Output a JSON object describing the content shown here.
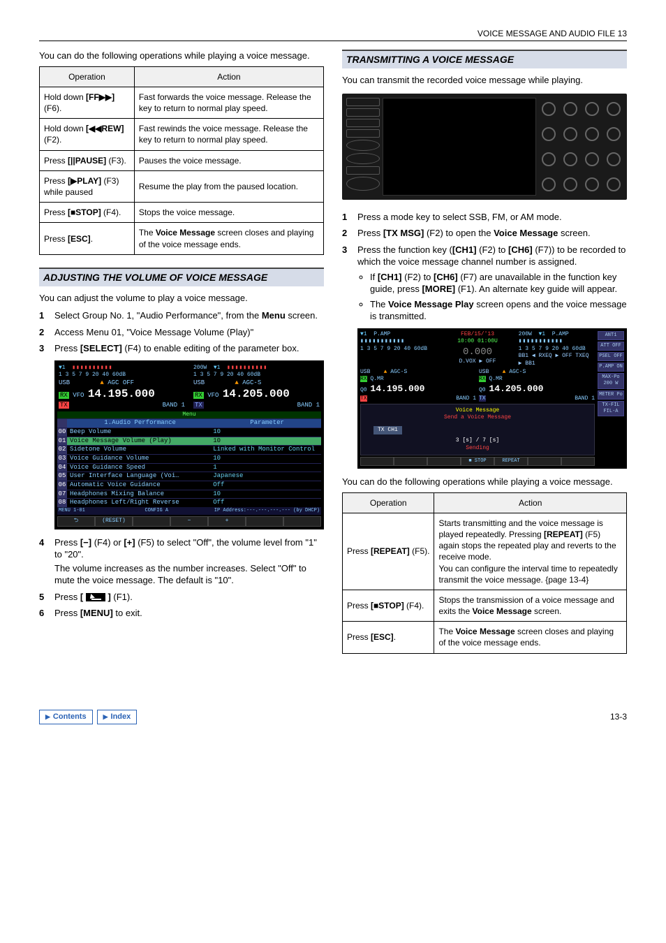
{
  "header": "VOICE MESSAGE AND AUDIO FILE 13",
  "left": {
    "intro": "You can do the following operations while playing a voice message.",
    "table": {
      "headers": [
        "Operation",
        "Action"
      ],
      "rows": [
        {
          "op_pre": "Hold down ",
          "op_b": "[FF▶▶]",
          "op_post": " (F6).",
          "act": "Fast forwards the voice message. Release the key to return to normal play speed."
        },
        {
          "op_pre": "Hold down ",
          "op_b": "[◀◀REW]",
          "op_post": " (F2).",
          "act": "Fast rewinds the voice message. Release the key to return to normal play speed."
        },
        {
          "op_pre": "Press ",
          "op_b": "[||PAUSE]",
          "op_post": " (F3).",
          "act": "Pauses the voice message."
        },
        {
          "op_pre": "Press ",
          "op_b": "[▶PLAY]",
          "op_post": " (F3) while paused",
          "act": "Resume the play from the paused location."
        },
        {
          "op_pre": "Press ",
          "op_b": "[■STOP]",
          "op_post": " (F4).",
          "act": "Stops the voice message."
        },
        {
          "op_pre": "Press ",
          "op_b": "[ESC]",
          "op_post": ".",
          "act_pre": "The ",
          "act_b": "Voice Message",
          "act_post": " screen closes and playing of the voice message ends."
        }
      ]
    },
    "sec2_title": "ADJUSTING THE VOLUME OF VOICE MESSAGE",
    "sec2_intro": "You can adjust the volume to play a voice message.",
    "steps1": {
      "s1_a": "Select Group No. 1, \"Audio Performance\", from the ",
      "s1_b": "Menu",
      "s1_c": " screen.",
      "s2": "Access Menu 01, \"Voice Message Volume (Play)\"",
      "s3_a": "Press ",
      "s3_b": "[SELECT]",
      "s3_c": " (F4) to enable editing of the parameter box."
    },
    "menu_shot": {
      "left_mode": "USB",
      "left_rxtx": "RX\nTX",
      "left_vfo": "VFO",
      "left_freq": "14.195.000",
      "left_band": "BAND 1",
      "agc_left": "AGC OFF",
      "right_mode": "USB",
      "right_vfo": "VFO",
      "right_freq": "14.205.000",
      "right_band": "BAND 1",
      "agc_right": "AGC-S",
      "scale": "1  3  5  7  9   20  40 60dB",
      "power": "200W",
      "menu_header_left": "1.Audio Performance",
      "menu_header_right": "Parameter",
      "rows": [
        [
          "00",
          "Beep Volume",
          "10"
        ],
        [
          "01",
          "Voice Message Volume (Play)",
          "10"
        ],
        [
          "02",
          "Sidetone Volume",
          "Linked with Monitor Control"
        ],
        [
          "03",
          "Voice Guidance Volume",
          "10"
        ],
        [
          "04",
          "Voice Guidance Speed",
          "1"
        ],
        [
          "05",
          "User Interface Language (Voi…",
          "Japanese"
        ],
        [
          "06",
          "Automatic Voice Guidance",
          "Off"
        ],
        [
          "07",
          "Headphones Mixing Balance",
          "10"
        ],
        [
          "08",
          "Headphones Left/Right Reverse",
          "Off"
        ]
      ],
      "status_left": "MENU 1-01",
      "status_mid": "CONFIG A",
      "status_right": "IP Address:---.---.---.--- (by DHCP)",
      "fkeys": [
        "⮌",
        "(RESET)",
        "",
        "−",
        "+",
        "",
        ""
      ]
    },
    "steps2": {
      "s4_a": "Press ",
      "s4_b": "[−]",
      "s4_c": " (F4) or ",
      "s4_d": "[+]",
      "s4_e": " (F5) to select \"Off\", the volume level from \"1\" to \"20\".",
      "s4_note": "The volume increases as the number increases. Select \"Off\" to mute the voice message. The default is \"10\".",
      "s5_a": "Press ",
      "s5_b": "[",
      "s5_c": "]",
      "s5_d": " (F1).",
      "s6_a": "Press ",
      "s6_b": "[MENU]",
      "s6_c": " to exit."
    }
  },
  "right": {
    "sec_title": "TRANSMITTING A VOICE MESSAGE",
    "intro": "You can transmit the recorded voice message while playing.",
    "steps": {
      "s1": "Press a mode key to select SSB, FM, or AM mode.",
      "s2_a": "Press ",
      "s2_b": "[TX MSG]",
      "s2_c": " (F2) to open the ",
      "s2_d": "Voice Message",
      "s2_e": " screen.",
      "s3_a": "Press the function key (",
      "s3_b": "[CH1]",
      "s3_c": " (F2) to ",
      "s3_d": "[CH6]",
      "s3_e": " (F7)) to be recorded to which the voice message channel number is assigned.",
      "b1_a": "If ",
      "b1_b": "[CH1]",
      "b1_c": " (F2) to ",
      "b1_d": "[CH6]",
      "b1_e": " (F7) are unavailable in the function key guide, press ",
      "b1_f": "[MORE]",
      "b1_g": " (F1). An alternate key guide will appear.",
      "b2_a": "The ",
      "b2_b": "Voice Message Play",
      "b2_c": " screen opens and the voice message is transmitted."
    },
    "trans_shot": {
      "pamp": "P.AMP",
      "date": "FEB/15/'13",
      "time": "10:00 01:00U",
      "zero": "0.000",
      "power": "200W",
      "ant": "ANT1",
      "dvox": "D.VOX ▶ OFF",
      "bb": "BB1 ◀ RXEQ ▶ OFF   TXEQ ▶ BB1",
      "left_mode": "USB",
      "left_rxtx": "RX\nTX",
      "left_qmr": "Q.MR\nQ0",
      "left_freq": "14.195.000",
      "left_band": "BAND 1",
      "left_agc": "AGC-S",
      "right_mode": "USB",
      "right_qmr": "Q.MR\nQ0",
      "right_freq": "14.205.000",
      "right_band": "BAND 1",
      "right_agc": "AGC-S",
      "side": [
        "ATT OFF",
        "PSEL OFF",
        "P.AMP ON",
        "MAX-Po 200 W",
        "METER Po",
        "TX-FIL FIL-A"
      ],
      "vm_title": "Voice Message",
      "vm_sub": "Send a Voice Message",
      "txch": "TX CH1",
      "timer": "3 [s]   /   7 [s]",
      "sending": "Sending",
      "fkeys": [
        "",
        "",
        "",
        "■ STOP",
        "REPEAT",
        "",
        ""
      ]
    },
    "outro": "You can do the following operations while playing a voice message.",
    "table": {
      "headers": [
        "Operation",
        "Action"
      ],
      "rows": [
        {
          "op_pre": "Press ",
          "op_b": "[REPEAT]",
          "op_post": " (F5).",
          "act_pre": "Starts transmitting and the voice message is played repeatedly. Pressing ",
          "act_b": "[REPEAT]",
          "act_mid": " (F5) again stops the repeated play and reverts to the receive mode.\nYou can configure the interval time to repeatedly transmit the voice message. ",
          "act_link": "{page 13-4}"
        },
        {
          "op_pre": "Press ",
          "op_b": "[■STOP]",
          "op_post": " (F4).",
          "act_pre": "Stops the transmission of a voice message and exits the ",
          "act_b": "Voice Message",
          "act_post": " screen."
        },
        {
          "op_pre": "Press ",
          "op_b": "[ESC]",
          "op_post": ".",
          "act_pre": "The ",
          "act_b": "Voice Message",
          "act_post": " screen closes and playing of the voice message ends."
        }
      ]
    }
  },
  "footer": {
    "contents": "Contents",
    "index": "Index",
    "page": "13-3"
  }
}
